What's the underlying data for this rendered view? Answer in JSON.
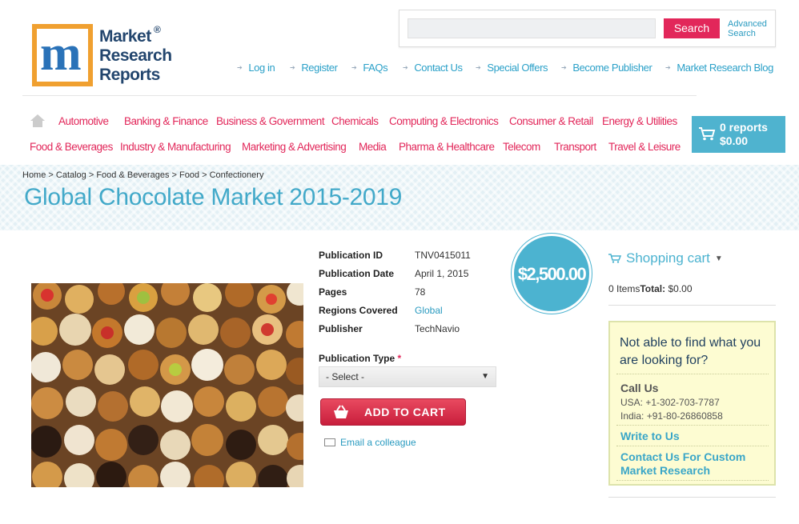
{
  "logo": {
    "line1": "Market",
    "line2": "Research",
    "line3": "Reports",
    "reg": "®"
  },
  "search": {
    "placeholder": "",
    "button": "Search",
    "advanced": "Advanced Search"
  },
  "top_links": [
    "Log in",
    "Register",
    "FAQs",
    "Contact Us",
    "Special Offers",
    "Become Publisher",
    "Market Research Blog"
  ],
  "nav": {
    "row1": [
      "Automotive",
      "Banking & Finance",
      "Business & Government",
      "Chemicals",
      "Computing & Electronics",
      "Consumer & Retail",
      "Energy & Utilities"
    ],
    "row2": [
      "Food & Beverages",
      "Industry & Manufacturing",
      "Marketing & Advertising",
      "Media",
      "Pharma & Healthcare",
      "Telecom",
      "Transport",
      "Travel & Leisure"
    ]
  },
  "cart": {
    "reports": "0 reports",
    "total": "$0.00"
  },
  "breadcrumb": "Home > Catalog > Food & Beverages > Food > Confectionery",
  "title": "Global Chocolate Market 2015-2019",
  "specs": [
    {
      "label": "Publication ID",
      "value": "TNV0415011"
    },
    {
      "label": "Publication Date",
      "value": "April 1, 2015"
    },
    {
      "label": "Pages",
      "value": "78"
    },
    {
      "label": "Regions Covered",
      "value": "Global"
    },
    {
      "label": "Publisher",
      "value": "TechNavio"
    }
  ],
  "price": "$2,500.00",
  "pub_type": {
    "label": "Publication Type",
    "required": "*",
    "selected": "- Select -"
  },
  "add_to_cart": "ADD TO CART",
  "email_colleague": "Email a colleague",
  "shopping_cart": {
    "title": "Shopping cart",
    "items": "0 Items",
    "total_label": "Total:",
    "total": "$0.00"
  },
  "help": {
    "question": "Not able to find what you are looking for?",
    "call_us": "Call Us",
    "usa": "USA: +1-302-703-7787",
    "india": "India: +91-80-26860858",
    "write_to_us": "Write to Us",
    "custom": "Contact Us For Custom Market Research"
  },
  "colors": {
    "accent": "#e2275a",
    "teal": "#4cb3d0",
    "link": "#2a9bc0"
  }
}
